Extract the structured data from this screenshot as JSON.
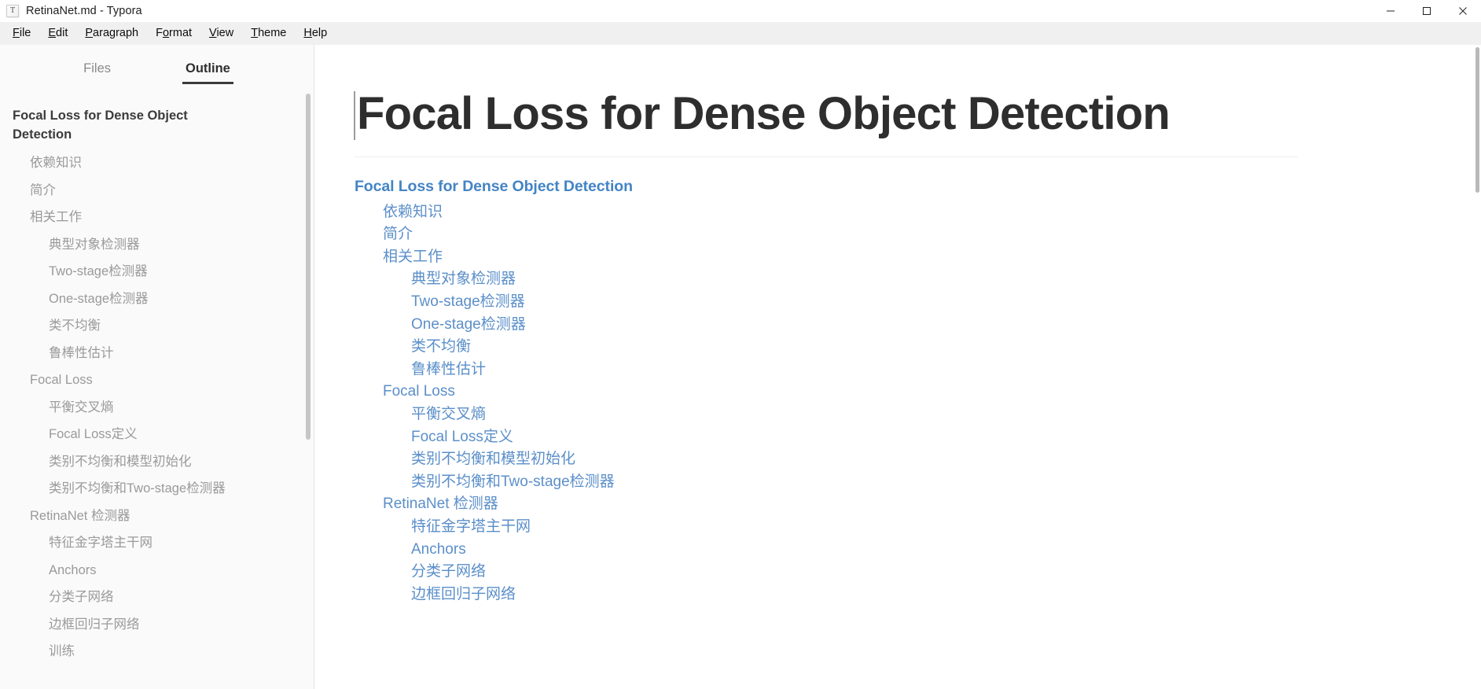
{
  "window": {
    "app_icon_glyph": "T",
    "title": "RetinaNet.md - Typora",
    "controls": [
      {
        "name": "minimize",
        "label": "Minimize"
      },
      {
        "name": "maximize",
        "label": "Maximize"
      },
      {
        "name": "close",
        "label": "Close"
      }
    ]
  },
  "menubar": {
    "items": [
      {
        "label": "File",
        "accel": "F"
      },
      {
        "label": "Edit",
        "accel": "E"
      },
      {
        "label": "Paragraph",
        "accel": "P"
      },
      {
        "label": "Format",
        "accel": "o"
      },
      {
        "label": "View",
        "accel": "V"
      },
      {
        "label": "Theme",
        "accel": "T"
      },
      {
        "label": "Help",
        "accel": "H"
      }
    ]
  },
  "sidebar": {
    "tabs": [
      {
        "label": "Files",
        "active": false
      },
      {
        "label": "Outline",
        "active": true
      }
    ],
    "outline": [
      {
        "label": "Focal Loss for Dense Object Detection",
        "level": 1
      },
      {
        "label": "依赖知识",
        "level": 2
      },
      {
        "label": "简介",
        "level": 2
      },
      {
        "label": "相关工作",
        "level": 2
      },
      {
        "label": "典型对象检测器",
        "level": 3
      },
      {
        "label": "Two-stage检测器",
        "level": 3
      },
      {
        "label": "One-stage检测器",
        "level": 3
      },
      {
        "label": "类不均衡",
        "level": 3
      },
      {
        "label": "鲁棒性估计",
        "level": 3
      },
      {
        "label": "Focal Loss",
        "level": 2
      },
      {
        "label": "平衡交叉熵",
        "level": 3
      },
      {
        "label": "Focal Loss定义",
        "level": 3
      },
      {
        "label": "类别不均衡和模型初始化",
        "level": 3
      },
      {
        "label": "类别不均衡和Two-stage检测器",
        "level": 3
      },
      {
        "label": "RetinaNet 检测器",
        "level": 2
      },
      {
        "label": "特征金字塔主干网",
        "level": 3
      },
      {
        "label": "Anchors",
        "level": 3
      },
      {
        "label": "分类子网络",
        "level": 3
      },
      {
        "label": "边框回归子网络",
        "level": 3
      },
      {
        "label": "训练",
        "level": 3
      }
    ]
  },
  "document": {
    "title": "Focal Loss for Dense Object Detection",
    "toc": [
      {
        "label": "Focal Loss for Dense Object Detection",
        "level": 1
      },
      {
        "label": "依赖知识",
        "level": 2
      },
      {
        "label": "简介",
        "level": 2
      },
      {
        "label": "相关工作",
        "level": 2
      },
      {
        "label": "典型对象检测器",
        "level": 3
      },
      {
        "label": "Two-stage检测器",
        "level": 3
      },
      {
        "label": "One-stage检测器",
        "level": 3
      },
      {
        "label": "类不均衡",
        "level": 3
      },
      {
        "label": "鲁棒性估计",
        "level": 3
      },
      {
        "label": "Focal Loss",
        "level": 2
      },
      {
        "label": "平衡交叉熵",
        "level": 3
      },
      {
        "label": "Focal Loss定义",
        "level": 3
      },
      {
        "label": "类别不均衡和模型初始化",
        "level": 3
      },
      {
        "label": "类别不均衡和Two-stage检测器",
        "level": 3
      },
      {
        "label": "RetinaNet 检测器",
        "level": 2
      },
      {
        "label": "特征金字塔主干网",
        "level": 3
      },
      {
        "label": "Anchors",
        "level": 3
      },
      {
        "label": "分类子网络",
        "level": 3
      },
      {
        "label": "边框回归子网络",
        "level": 3
      }
    ]
  },
  "colors": {
    "link": "#5b8fc9",
    "link_heading": "#4484c4",
    "sidebar_bg": "#fafafa",
    "menubar_bg": "#f0f0f0",
    "text_primary": "#2e2e2e",
    "text_muted": "#9a9a9a"
  }
}
